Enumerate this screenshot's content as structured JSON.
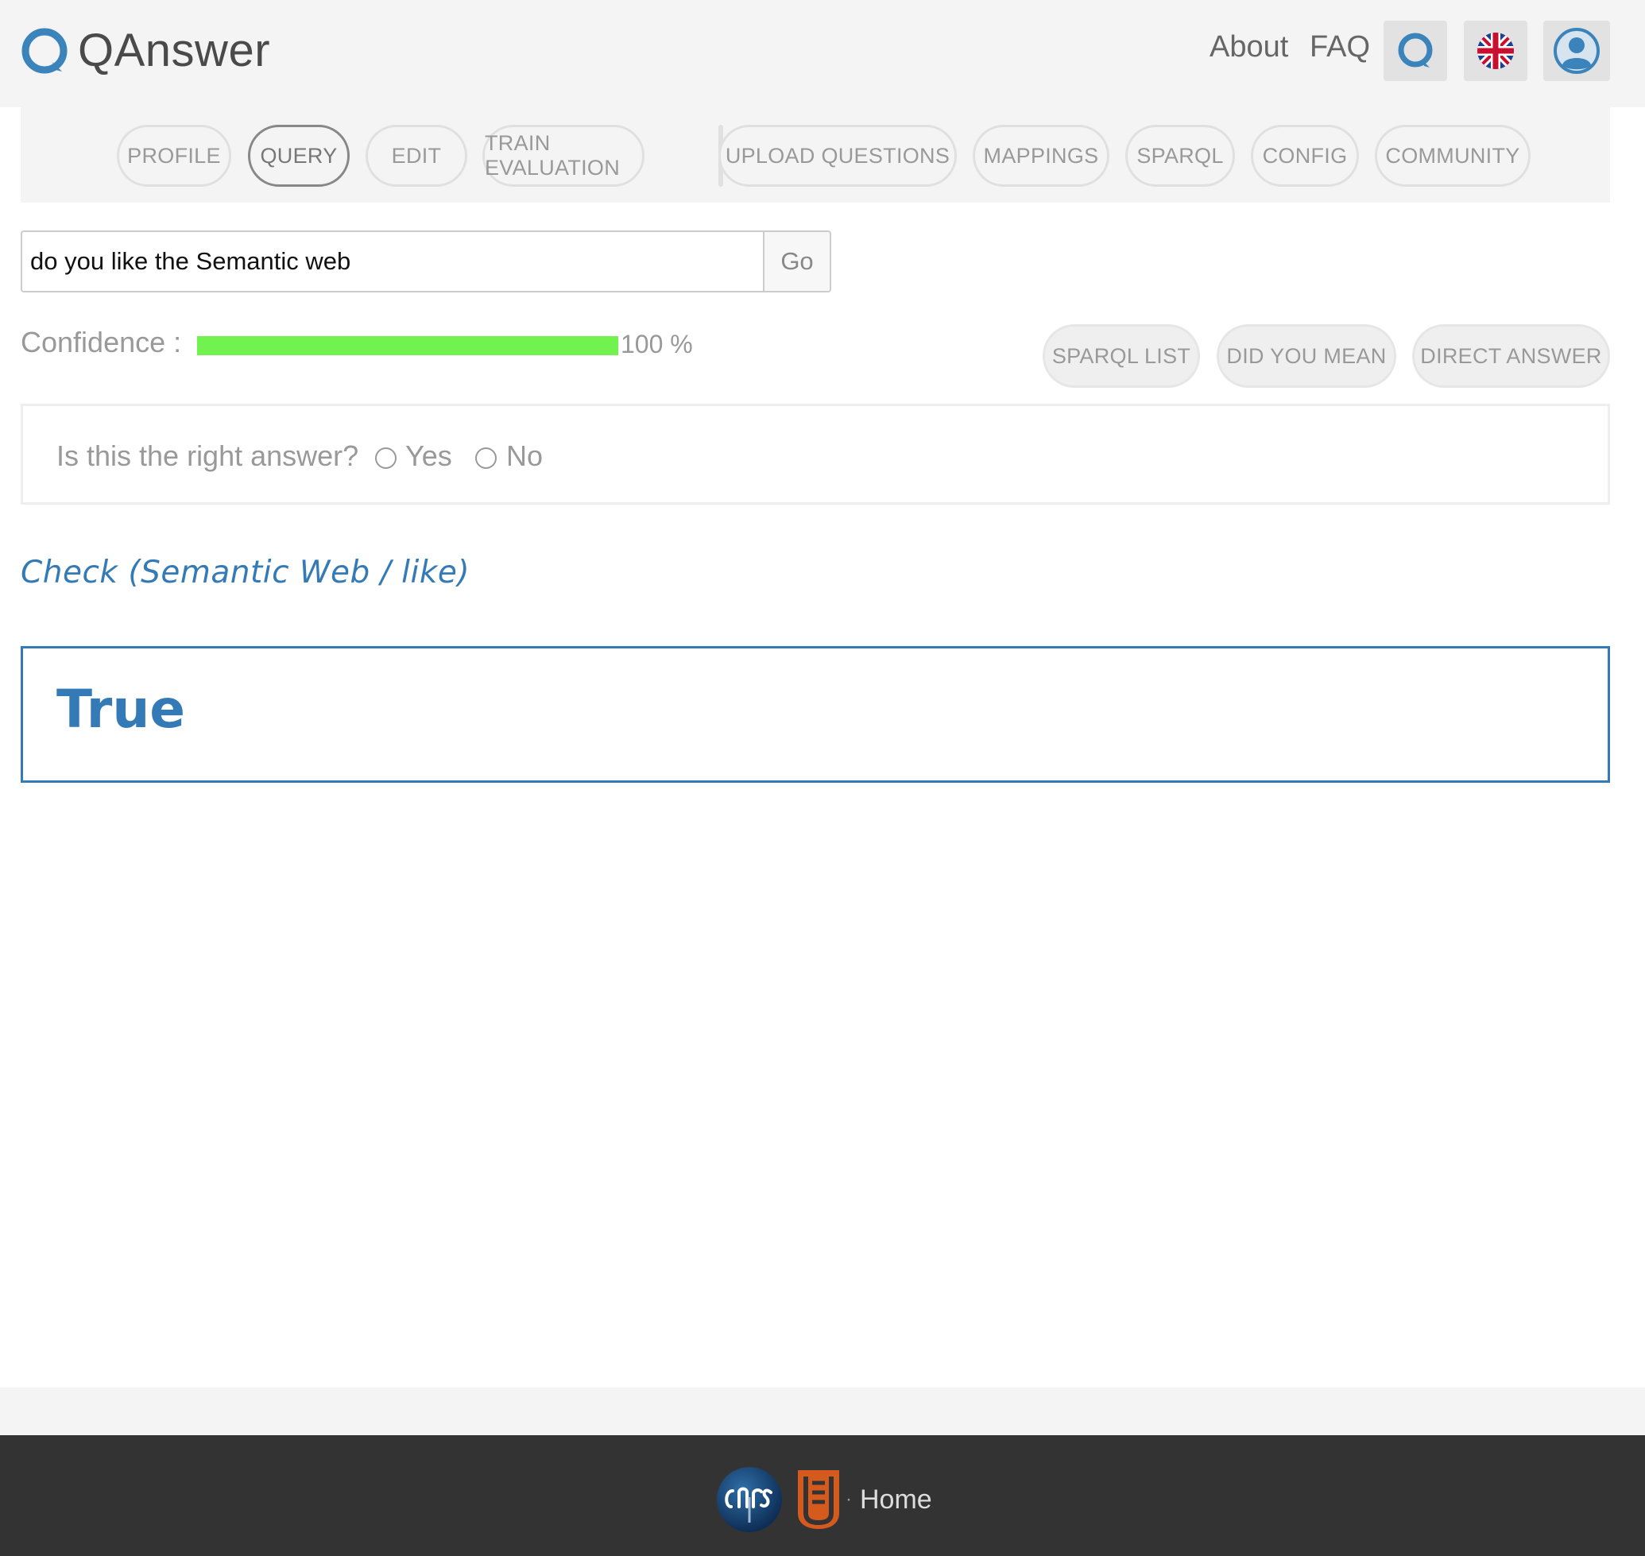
{
  "header": {
    "logo_text": "QAnswer",
    "nav": {
      "about": "About",
      "faq": "FAQ"
    },
    "icons": {
      "qa": "qanswer-logo-icon",
      "lang": "uk-flag-icon",
      "user": "user-avatar-icon"
    }
  },
  "tabs": [
    {
      "label": "PROFILE",
      "active": false
    },
    {
      "label": "QUERY",
      "active": true
    },
    {
      "label": "EDIT",
      "active": false
    },
    {
      "label": "TRAIN EVALUATION",
      "active": false
    },
    {
      "label": "UPLOAD QUESTIONS",
      "active": false
    },
    {
      "label": "MAPPINGS",
      "active": false
    },
    {
      "label": "SPARQL",
      "active": false
    },
    {
      "label": "CONFIG",
      "active": false
    },
    {
      "label": "COMMUNITY",
      "active": false
    }
  ],
  "search": {
    "value": "do you like the Semantic web",
    "go_label": "Go"
  },
  "confidence": {
    "label": "Confidence :",
    "value_text": "100 %",
    "fraction": 1.0,
    "color": "#72f24e"
  },
  "options": {
    "sparql_list": "SPARQL LIST",
    "did_you_mean": "DID YOU MEAN",
    "direct_answer": "DIRECT ANSWER"
  },
  "feedback": {
    "question": "Is this the right answer?",
    "yes": "Yes",
    "no": "No"
  },
  "answer": {
    "check_link": "Check (Semantic Web / like)",
    "result": "True",
    "accent_color": "#337ab7"
  },
  "footer": {
    "home": "Home"
  }
}
